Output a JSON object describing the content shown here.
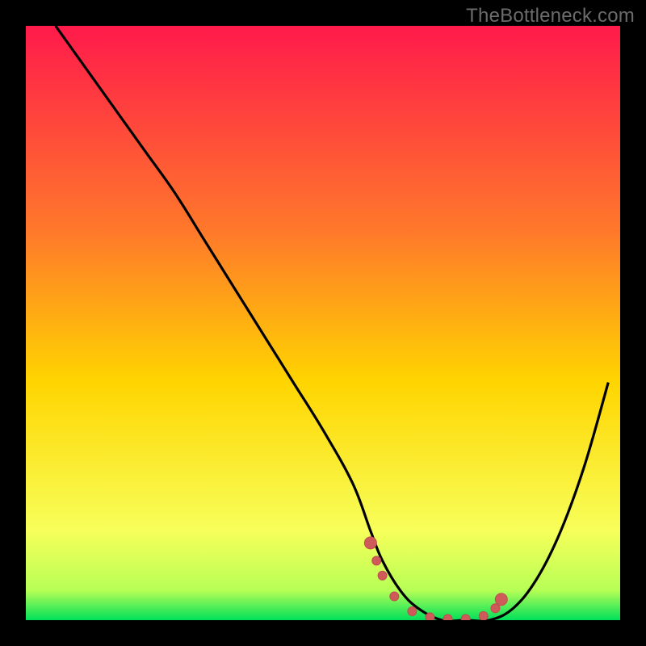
{
  "watermark": "TheBottleneck.com",
  "colors": {
    "frame_border": "#000000",
    "gradient_top": "#ff1a4b",
    "gradient_mid": "#ffd500",
    "gradient_low": "#f7ff5a",
    "gradient_bottom": "#00e05a",
    "curve": "#000000",
    "marker": "#cf5a5a",
    "marker_stroke": "#c24d4d"
  },
  "chart_data": {
    "type": "line",
    "title": "",
    "xlabel": "",
    "ylabel": "",
    "xlim": [
      0,
      100
    ],
    "ylim": [
      0,
      100
    ],
    "series": [
      {
        "name": "bottleneck-curve",
        "x": [
          5,
          10,
          15,
          20,
          25,
          30,
          35,
          40,
          45,
          50,
          55,
          58,
          60,
          63,
          66,
          70,
          74,
          78,
          82,
          86,
          90,
          94,
          98
        ],
        "y": [
          100,
          93,
          86,
          79,
          72,
          64,
          56,
          48,
          40,
          32,
          23,
          15,
          10,
          5,
          2,
          0,
          0,
          0,
          2,
          7,
          15,
          26,
          40
        ]
      }
    ],
    "optimal_range_markers": {
      "name": "optimal-zone",
      "points": [
        {
          "x": 58,
          "y": 13
        },
        {
          "x": 59,
          "y": 10
        },
        {
          "x": 60,
          "y": 7.5
        },
        {
          "x": 62,
          "y": 4
        },
        {
          "x": 65,
          "y": 1.5
        },
        {
          "x": 68,
          "y": 0.5
        },
        {
          "x": 71,
          "y": 0.2
        },
        {
          "x": 74,
          "y": 0.2
        },
        {
          "x": 77,
          "y": 0.7
        },
        {
          "x": 79,
          "y": 2
        },
        {
          "x": 80,
          "y": 3.5
        }
      ]
    }
  }
}
